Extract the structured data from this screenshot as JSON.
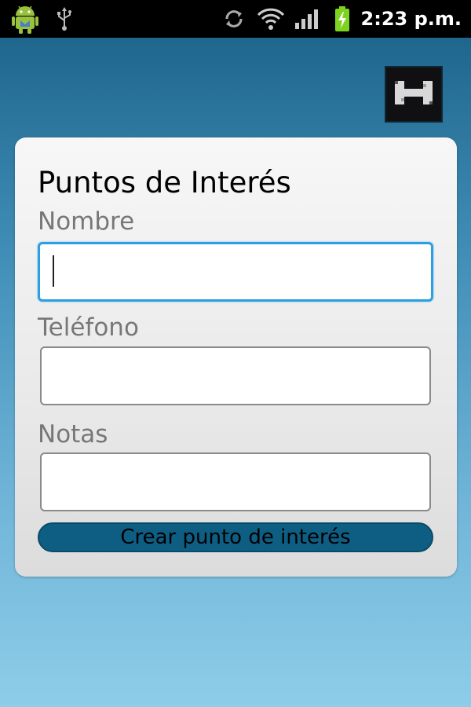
{
  "status_bar": {
    "time": "2:23 p.m.",
    "icons": [
      "android-debug-icon",
      "usb-icon",
      "sync-icon",
      "wifi-icon",
      "signal-icon",
      "battery-charging-icon"
    ],
    "colors": {
      "battery": "#7ed321",
      "background": "#000000"
    }
  },
  "header": {
    "logo_icon": "h-logo-icon"
  },
  "form": {
    "title": "Puntos de Interés",
    "fields": [
      {
        "label": "Nombre",
        "value": "",
        "focused": true
      },
      {
        "label": "Teléfono",
        "value": ""
      },
      {
        "label": "Notas",
        "value": ""
      }
    ],
    "submit_label": "Crear punto de interés"
  },
  "colors": {
    "background_top": "#1a5f86",
    "background_bottom": "#8dcde8",
    "focus_border": "#2b9fe0",
    "button": "#0e5e84"
  }
}
